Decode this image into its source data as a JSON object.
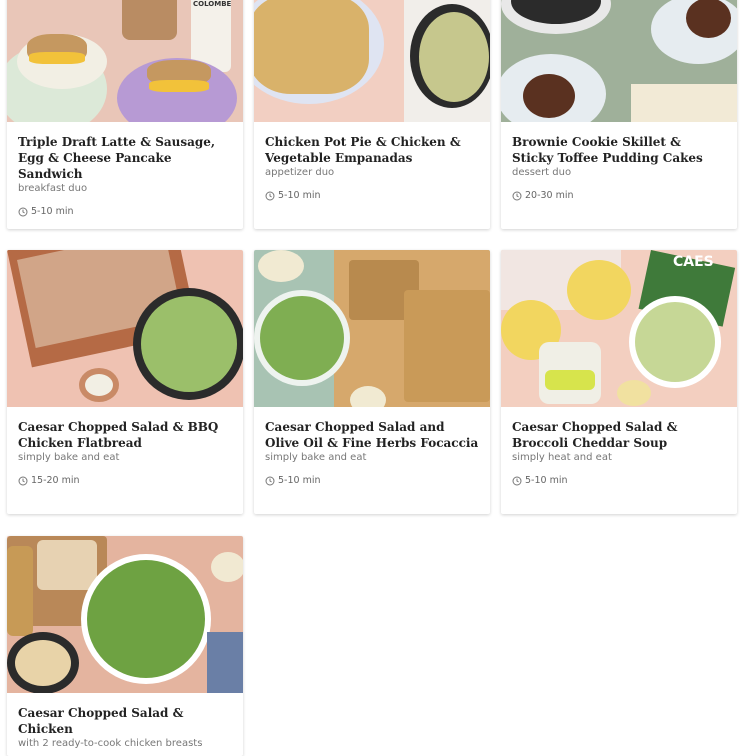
{
  "cards": [
    {
      "title": "Triple Draft Latte & Sausage, Egg & Cheese Pancake Sandwich",
      "subtitle": "breakfast duo",
      "time": "5-10 min",
      "image_label": "COLOMBE"
    },
    {
      "title": "Chicken Pot Pie & Chicken & Vegetable Empanadas",
      "subtitle": "appetizer duo",
      "time": "5-10 min"
    },
    {
      "title": "Brownie Cookie Skillet & Sticky Toffee Pudding Cakes",
      "subtitle": "dessert duo",
      "time": "20-30 min"
    },
    {
      "title": "Caesar Chopped Salad & BBQ Chicken Flatbread",
      "subtitle": "simply bake and eat",
      "time": "15-20 min"
    },
    {
      "title": "Caesar Chopped Salad and Olive Oil & Fine Herbs Focaccia",
      "subtitle": "simply bake and eat",
      "time": "5-10 min"
    },
    {
      "title": "Caesar Chopped Salad & Broccoli Cheddar Soup",
      "subtitle": "simply heat and eat",
      "time": "5-10 min",
      "image_label": "CAES"
    },
    {
      "title": "Caesar Chopped Salad & Chicken",
      "subtitle": "with 2 ready-to-cook chicken breasts",
      "time": ""
    }
  ]
}
